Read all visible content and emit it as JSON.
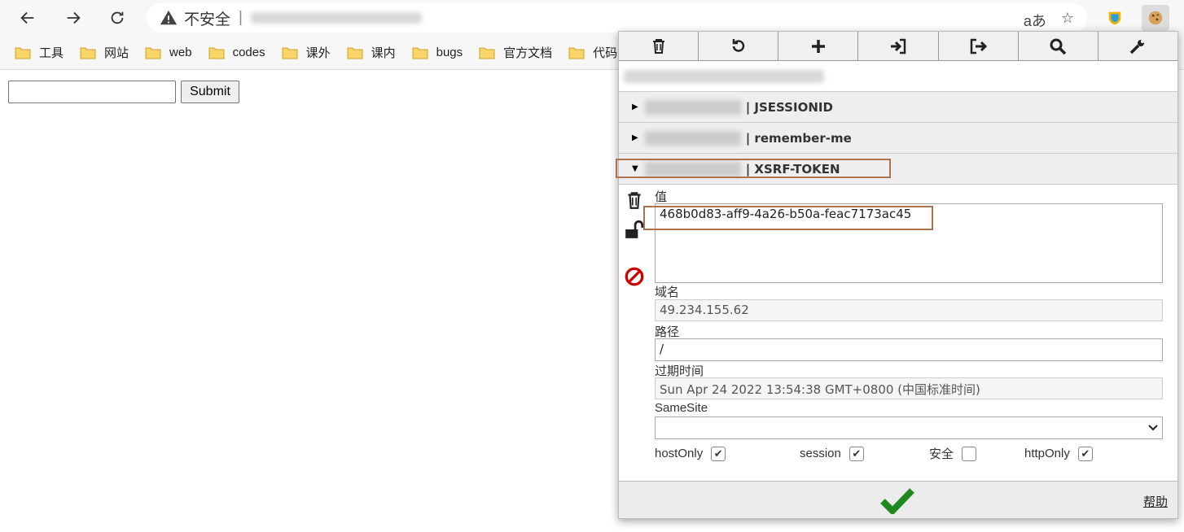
{
  "browser": {
    "address_security_label": "不安全",
    "address_sep": "|",
    "bookmarks": [
      "工具",
      "网站",
      "web",
      "codes",
      "课外",
      "课内",
      "bugs",
      "官方文档",
      "代码"
    ]
  },
  "page": {
    "submit_label": "Submit",
    "input_value": ""
  },
  "popup": {
    "cookies": [
      {
        "name": "JSESSIONID",
        "expanded": false
      },
      {
        "name": "remember-me",
        "expanded": false
      },
      {
        "name": "XSRF-TOKEN",
        "expanded": true
      }
    ],
    "separator": "|",
    "detail": {
      "value_label": "值",
      "value": "468b0d83-aff9-4a26-b50a-feac7173ac45",
      "domain_label": "域名",
      "domain": "49.234.155.62",
      "path_label": "路径",
      "path": "/",
      "expires_label": "过期时间",
      "expires": "Sun Apr 24 2022 13:54:38 GMT+0800 (中国标准时间)",
      "samesite_label": "SameSite",
      "samesite_value": "",
      "flags": [
        {
          "label": "hostOnly",
          "checked": true
        },
        {
          "label": "session",
          "checked": true
        },
        {
          "label": "安全",
          "checked": false
        },
        {
          "label": "httpOnly",
          "checked": true
        }
      ]
    },
    "help_label": "帮助"
  },
  "colors": {
    "highlight": "#b07050",
    "ok_green": "#1e8a1e",
    "block_red": "#cc0000"
  }
}
